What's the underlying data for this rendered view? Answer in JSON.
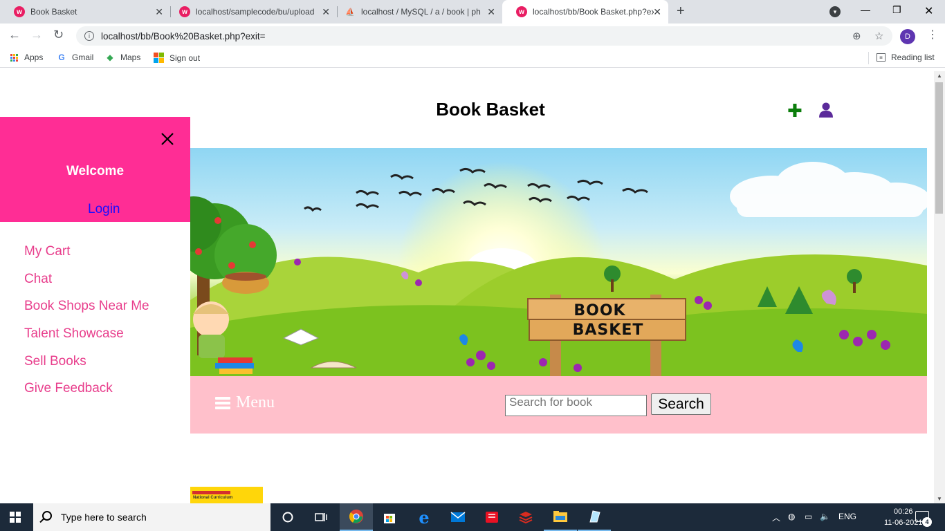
{
  "browser": {
    "tabs": [
      {
        "title": "Book Basket",
        "active": false
      },
      {
        "title": "localhost/samplecode/bu/upload",
        "active": false
      },
      {
        "title": "localhost / MySQL / a / book | ph",
        "active": false
      },
      {
        "title": "localhost/bb/Book Basket.php?exit=",
        "active": true
      }
    ],
    "url": "localhost/bb/Book%20Basket.php?exit=",
    "avatar_letter": "D",
    "bookmarks": [
      "Apps",
      "Gmail",
      "Maps",
      "Sign out"
    ],
    "reading_list": "Reading list"
  },
  "site": {
    "title": "Book Basket",
    "sign_text": [
      "BOOK",
      "BASKET"
    ]
  },
  "sidenav": {
    "welcome": "Welcome",
    "login": "Login",
    "items": [
      "My Cart",
      "Chat",
      "Book Shops Near Me",
      "Talent Showcase",
      "Sell Books",
      "Give Feedback"
    ]
  },
  "menubar": {
    "menu_label": "Menu",
    "search_placeholder": "Search for book",
    "search_button": "Search"
  },
  "thumb": {
    "caption": "National Curriculum"
  },
  "taskbar": {
    "search_placeholder": "Type here to search",
    "language": "ENG",
    "time": "00:26",
    "date": "11-06-2021",
    "notification_count": "4"
  },
  "colors": {
    "sidenav_header": "#ff2d95",
    "sidenav_link": "#e83e8c",
    "login_link": "#1a0dff",
    "menubar": "#ffc0cb",
    "plus_icon": "#0b7d0b",
    "user_icon": "#5b2a9a"
  }
}
